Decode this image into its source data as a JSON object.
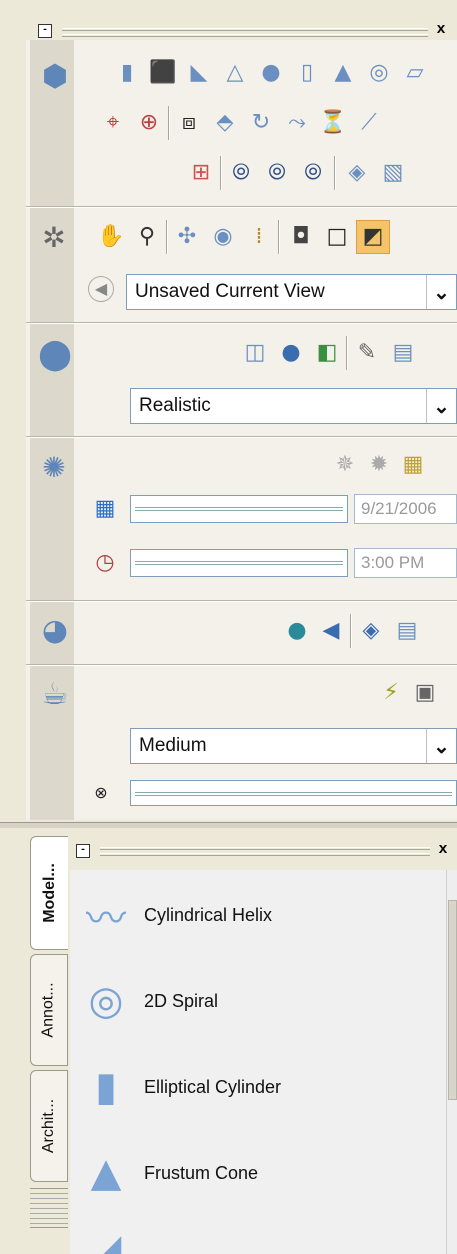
{
  "top_palette": {
    "title_minimize": "-",
    "title_close": "x"
  },
  "navigation": {
    "view_label": "Unsaved Current View"
  },
  "visual_styles": {
    "style_label": "Realistic"
  },
  "lights": {
    "date_value": "9/21/2006",
    "time_value": "3:00 PM"
  },
  "render": {
    "quality_label": "Medium"
  },
  "tool_palette": {
    "title_minimize": "-",
    "title_close": "x",
    "tabs": [
      "Model...",
      "Annot...",
      "Archit..."
    ],
    "items": [
      {
        "label": "Cylindrical Helix",
        "icon": "helix-icon"
      },
      {
        "label": "2D Spiral",
        "icon": "spiral-icon"
      },
      {
        "label": "Elliptical Cylinder",
        "icon": "cylinder-icon"
      },
      {
        "label": "Frustum Cone",
        "icon": "cone-icon"
      }
    ]
  },
  "colors": {
    "panel_bg": "#ece9d8",
    "accent_blue": "#6a8fc0",
    "highlight_orange": "#f5c46a"
  }
}
